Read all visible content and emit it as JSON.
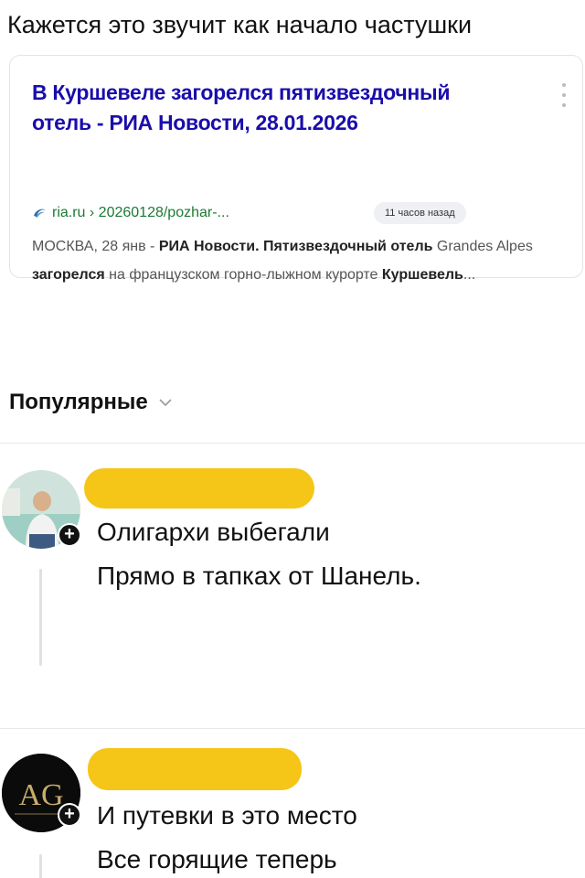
{
  "post": {
    "caption": "Кажется это звучит как начало частушки"
  },
  "search_result": {
    "title_line1": "В Куршевеле загорелся пятизвездочный",
    "title_line2": "отель - РИА Новости, 28.01.2026",
    "url": "ria.ru › 20260128/pozhar-...",
    "time_badge": "11 часов назад",
    "snippet": {
      "p1": "МОСКВА, 28 янв - ",
      "b1": "РИА Новости. Пятизвездочный отель",
      "p2": " Grandes Alpes ",
      "b2": "загорелся",
      "p3": " на французском горно-лыжном курорте ",
      "b3": "Куршевель",
      "p4": "..."
    }
  },
  "comments_header": {
    "label": "Популярные"
  },
  "comments": [
    {
      "line1": "Олигархи выбегали",
      "line2": "Прямо в тапках от Шанель."
    },
    {
      "line1": "И путевки в это место",
      "line2": "Все горящие теперь",
      "avatar_text": "AG"
    }
  ],
  "icons": {
    "source": "ria-logo-icon",
    "menu": "more-vertical-icon",
    "chevron": "chevron-down-icon",
    "subscribe": "plus-icon"
  },
  "colors": {
    "link": "#1a0dab",
    "url": "#1c7a35",
    "redaction": "#f5c518"
  }
}
